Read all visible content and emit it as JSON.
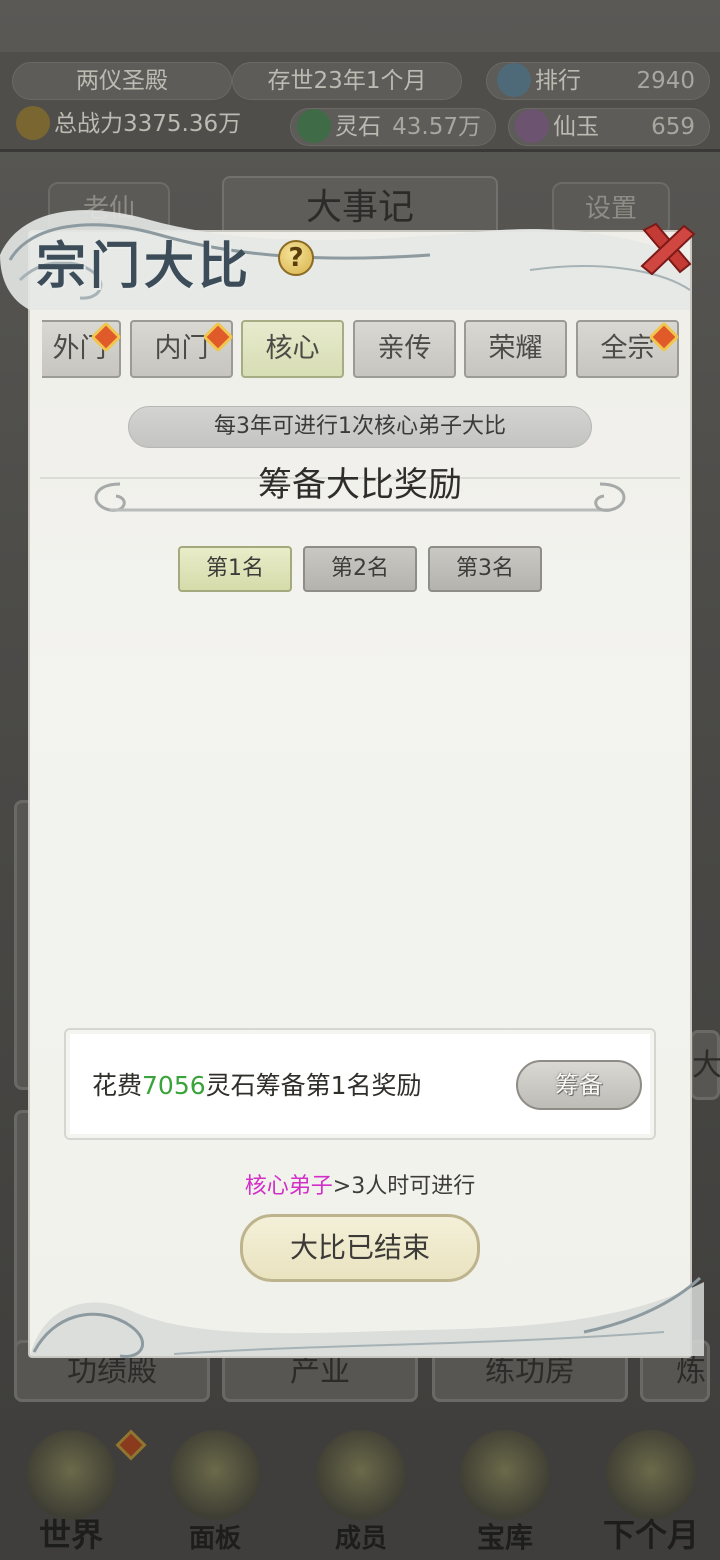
{
  "hud": {
    "sect_name": "两仪圣殿",
    "date": "存世23年1个月",
    "rank_label": "排行",
    "rank_value": "2940",
    "power": "总战力3375.36万",
    "stone_label": "灵石",
    "stone_value": "43.57万",
    "jade_label": "仙玉",
    "jade_value": "659"
  },
  "background": {
    "left_button": "老仙",
    "title": "大事记",
    "settings_button": "设置",
    "building_labels": [
      "功绩殿",
      "产业",
      "练功房",
      "炼"
    ],
    "side_char": "大"
  },
  "nav": {
    "items": [
      "世界",
      "面板",
      "成员",
      "宝库",
      "下个月"
    ]
  },
  "modal": {
    "title": "宗门大比",
    "help": "?",
    "tabs": [
      "外门",
      "内门",
      "核心",
      "亲传",
      "荣耀",
      "全宗"
    ],
    "active_tab": "核心",
    "info": "每3年可进行1次核心弟子大比",
    "section_title": "筹备大比奖励",
    "ranks": [
      "第1名",
      "第2名",
      "第3名"
    ],
    "cost_prefix": "花费",
    "cost_amount": "7056",
    "cost_suffix": "灵石筹备第1名奖励",
    "prepare_button": "筹备",
    "condition_highlight": "核心弟子",
    "condition_rest": ">3人时可进行",
    "main_button": "大比已结束"
  },
  "colors": {
    "active_tab": "#d7ddb4",
    "cost_amount": "#3aa33a",
    "condition_highlight": "#d22ec8",
    "badge": "#e15a2a"
  }
}
